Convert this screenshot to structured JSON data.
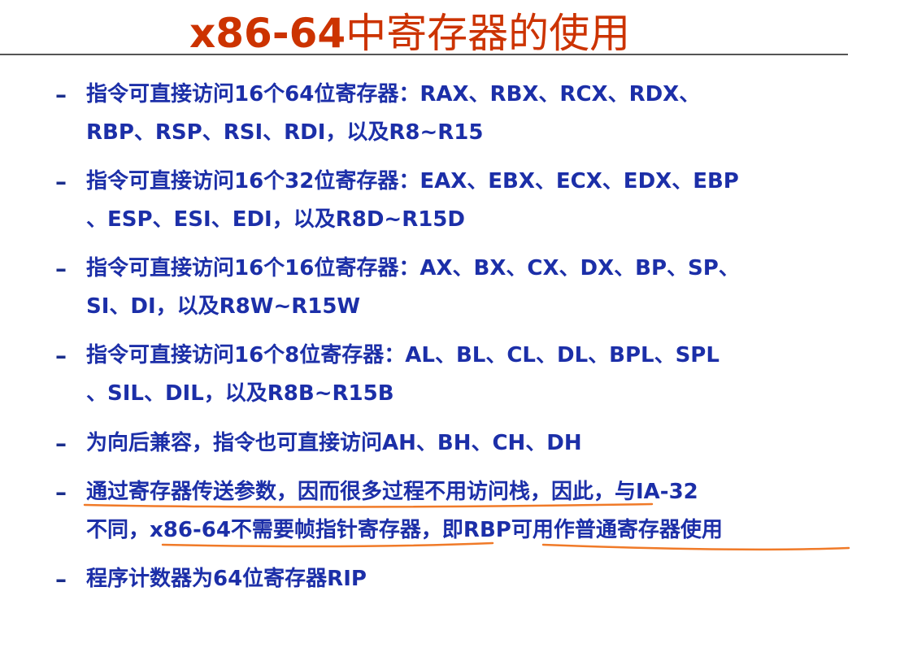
{
  "slide": {
    "title_prefix": "x86-64",
    "title_rest": "中寄存器的使用",
    "bullet_marker": "–",
    "bullets": [
      "指令可直接访问16个64位寄存器：RAX、RBX、RCX、RDX、\nRBP、RSP、RSI、RDI，以及R8~R15",
      "指令可直接访问16个32位寄存器：EAX、EBX、ECX、EDX、EBP\n、ESP、ESI、EDI，以及R8D~R15D",
      "指令可直接访问16个16位寄存器：AX、BX、CX、DX、BP、SP、\nSI、DI，以及R8W~R15W",
      "指令可直接访问16个8位寄存器：AL、BL、CL、DL、BPL、SPL\n、SIL、DIL，以及R8B~R15B",
      "为向后兼容，指令也可直接访问AH、BH、CH、DH",
      "通过寄存器传送参数，因而很多过程不用访问栈，因此，与IA-32\n不同，x86-64不需要帧指针寄存器，即RBP可用作普通寄存器使用",
      "程序计数器为64位寄存器RIP"
    ]
  },
  "colors": {
    "title": "#cc3300",
    "text": "#1c2fa8",
    "annotation": "#f07a28",
    "rule": "#555555"
  }
}
